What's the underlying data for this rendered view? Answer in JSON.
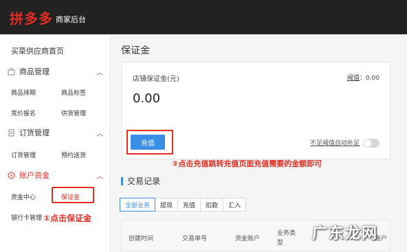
{
  "header": {
    "logo": "拼多多",
    "subtitle": "商家后台"
  },
  "sidebar": {
    "home": "买菜供应商首页",
    "sections": [
      {
        "title": "商品管理",
        "items": [
          "商品排期",
          "商品标签",
          "竞价报名",
          "供货管理"
        ]
      },
      {
        "title": "订货管理",
        "items": [
          "订货管理",
          "预约送货"
        ]
      },
      {
        "title": "账户资金",
        "items": [
          "资金中心",
          "保证金",
          "银行卡管理"
        ]
      }
    ]
  },
  "annotations": {
    "step1": "①点击保证金",
    "step2": "②点击充值跳转充值页面充值需要的金额即可"
  },
  "main": {
    "title": "保证金",
    "card": {
      "label": "店铺保证金(元)",
      "threshold_label": "阈值",
      "threshold_value": "0.00",
      "amount": "0.00",
      "recharge_button": "充值",
      "autofill_label": "不足阈值自动补足"
    },
    "transactions": {
      "title": "交易记录",
      "tabs": [
        "全部业务",
        "提现",
        "充值",
        "扣款",
        "汇入"
      ],
      "columns": [
        "创建时间",
        "交易单号",
        "资金账户",
        "业务类型",
        "账户"
      ]
    }
  },
  "watermark": "广东龙网",
  "colors": {
    "brand": "#e02e24",
    "accent": "#3a8ee6",
    "topbar": "#222222"
  }
}
